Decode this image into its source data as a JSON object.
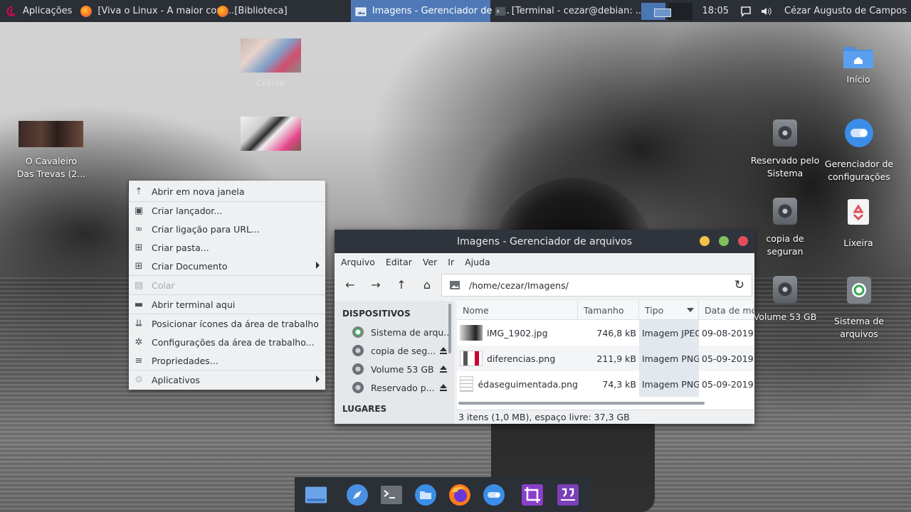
{
  "topbar": {
    "apps_label": "Aplicações",
    "window1": "[Viva o Linux - A maior com...",
    "window2": "[Biblioteca]",
    "window3": "Imagens - Gerenciador de a...",
    "window4": "[Terminal - cezar@debian: ...",
    "clock": "18:05",
    "user": "Cézar Augusto de Campos"
  },
  "desktop": {
    "icon_cranio": "Crânio",
    "icon_cavaleiro_l1": "O Cavaleiro",
    "icon_cavaleiro_l2": "Das Trevas (2...",
    "icon_inicio": "Início",
    "icon_reservado_l1": "Reservado pelo",
    "icon_reservado_l2": "Sistema",
    "icon_gerenciador_l1": "Gerenciador de",
    "icon_gerenciador_l2": "configurações",
    "icon_copia_l1": "copia de",
    "icon_copia_l2": "seguran",
    "icon_lixeira": "Lixeira",
    "icon_volume": "Volume 53 GB",
    "icon_sistema_l1": "Sistema de",
    "icon_sistema_l2": "arquivos"
  },
  "context_menu": {
    "items": [
      "Abrir em nova janela",
      "Criar lançador...",
      "Criar ligação para URL...",
      "Criar pasta...",
      "Criar Documento",
      "Colar",
      "Abrir terminal aqui",
      "Posicionar ícones da área de trabalho",
      "Configurações da área de trabalho...",
      "Propriedades...",
      "Aplicativos"
    ]
  },
  "file_manager": {
    "title": "Imagens - Gerenciador de arquivos",
    "menu": [
      "Arquivo",
      "Editar",
      "Ver",
      "Ir",
      "Ajuda"
    ],
    "path": "/home/cezar/Imagens/",
    "sidebar": {
      "devices_heading": "DISPOSITIVOS",
      "devices": [
        "Sistema de arqu...",
        "copia de seg...",
        "Volume 53 GB",
        "Reservado p..."
      ],
      "places_heading": "LUGARES"
    },
    "columns": [
      "Nome",
      "Tamanho",
      "Tipo",
      "Data de mod"
    ],
    "files": [
      {
        "name": "IMG_1902.jpg",
        "size": "746,8 kB",
        "type": "Imagem JPEG",
        "date": "09-08-2019"
      },
      {
        "name": "diferencias.png",
        "size": "211,9 kB",
        "type": "Imagem PNG",
        "date": "05-09-2019"
      },
      {
        "name": "édaseguimentada.png",
        "size": "74,3 kB",
        "type": "Imagem PNG",
        "date": "05-09-2019"
      }
    ],
    "status": "3 itens (1,0 MB), espaço livre: 37,3 GB"
  },
  "colors": {
    "panel": "#2b2f36",
    "accent": "#4f79b6",
    "close": "#e0505c",
    "minimize": "#f3c04a",
    "maximize": "#7dbf5d"
  }
}
